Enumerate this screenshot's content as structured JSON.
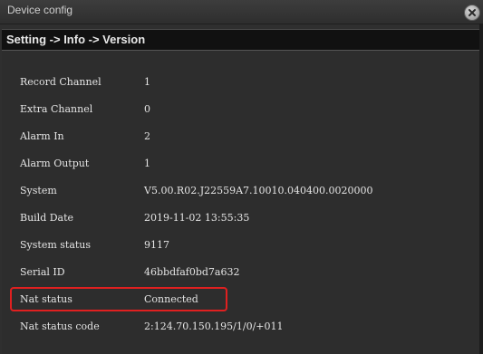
{
  "window": {
    "title": "Device config",
    "close_icon": "close-icon"
  },
  "breadcrumb": "Setting -> Info -> Version",
  "rows": [
    {
      "label": "Record Channel",
      "value": "1"
    },
    {
      "label": "Extra Channel",
      "value": "0"
    },
    {
      "label": "Alarm In",
      "value": "2"
    },
    {
      "label": "Alarm Output",
      "value": "1"
    },
    {
      "label": "System",
      "value": "V5.00.R02.J22559A7.10010.040400.0020000"
    },
    {
      "label": "Build Date",
      "value": "2019-11-02 13:55:35"
    },
    {
      "label": "System status",
      "value": "9117"
    },
    {
      "label": "Serial ID",
      "value": "46bbdfaf0bd7a632"
    },
    {
      "label": "Nat status",
      "value": "Connected"
    },
    {
      "label": "Nat status code",
      "value": "2:124.70.150.195/1/0/+011"
    }
  ],
  "colors": {
    "highlight": "#e02020",
    "background": "#2d2d2d",
    "header": "#111111"
  }
}
